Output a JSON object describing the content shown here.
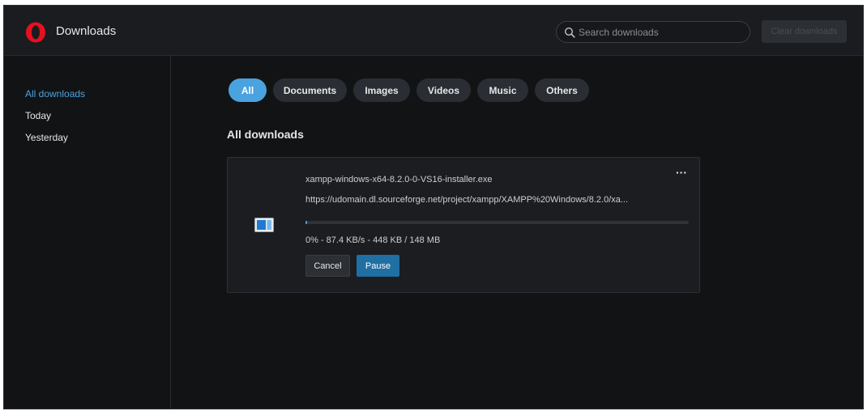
{
  "header": {
    "title": "Downloads",
    "search": {
      "placeholder": "Search downloads",
      "value": ""
    },
    "clear_label": "Clear downloads"
  },
  "sidebar": {
    "items": [
      {
        "label": "All downloads",
        "active": true
      },
      {
        "label": "Today",
        "active": false
      },
      {
        "label": "Yesterday",
        "active": false
      }
    ]
  },
  "filters": {
    "chips": [
      {
        "label": "All",
        "active": true
      },
      {
        "label": "Documents",
        "active": false
      },
      {
        "label": "Images",
        "active": false
      },
      {
        "label": "Videos",
        "active": false
      },
      {
        "label": "Music",
        "active": false
      },
      {
        "label": "Others",
        "active": false
      }
    ]
  },
  "main": {
    "section_title": "All downloads",
    "downloads": [
      {
        "file_name": "xampp-windows-x64-8.2.0-0-VS16-installer.exe",
        "url": "https://udomain.dl.sourceforge.net/project/xampp/XAMPP%20Windows/8.2.0/xa...",
        "progress": 0.003,
        "status": "0% - 87.4 KB/s - 448 KB / 148 MB",
        "more_label": "···",
        "cancel_label": "Cancel",
        "pause_label": "Pause"
      }
    ]
  },
  "colors": {
    "accent": "#4aa3df",
    "background": "#121315",
    "panel": "#1b1d21",
    "opera_red": "#e8101d"
  },
  "icons": {
    "logo": "opera-logo-icon",
    "search": "search-icon",
    "file": "installer-file-icon",
    "more": "more-options-icon"
  }
}
